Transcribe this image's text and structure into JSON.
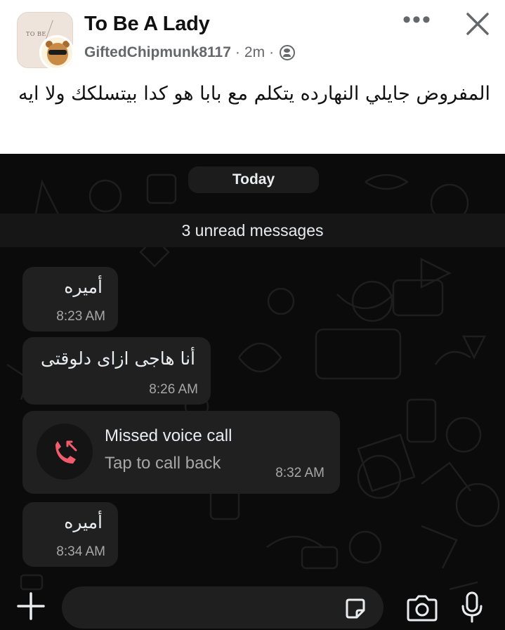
{
  "post": {
    "group_name": "To Be A Lady",
    "author": "GiftedChipmunk8117",
    "separator": "·",
    "time_ago": "2m",
    "more_label": "•••",
    "body": "المفروض جايلي النهارده يتكلم مع بابا هو كدا بيتسلكك ولا ايه",
    "group_avatar_text": "TO BE",
    "icons": {
      "group_avatar": "group-avatar",
      "user_avatar": "user-avatar",
      "privacy": "globe-icon",
      "more": "more-icon",
      "close": "close-icon"
    }
  },
  "chat": {
    "day_label": "Today",
    "unread_label": "3 unread messages",
    "messages": [
      {
        "text": "أميره",
        "time": "8:23 AM"
      },
      {
        "text": "أنا هاجى ازاى دلوقتى",
        "time": "8:26 AM"
      },
      {
        "text": "أميره",
        "time": "8:34 AM"
      }
    ],
    "missed_call": {
      "title": "Missed voice call",
      "subtitle": "Tap to call back",
      "time": "8:32 AM",
      "icon": "missed-call-icon",
      "accent": "#f15c6d"
    },
    "input": {
      "placeholder": "",
      "icons": [
        "plus-icon",
        "sticker-icon",
        "camera-icon",
        "mic-icon"
      ]
    },
    "colors": {
      "background": "#0b0b0b",
      "bubble": "#202020",
      "text": "#e9edef",
      "muted": "#a7a7a7"
    }
  }
}
